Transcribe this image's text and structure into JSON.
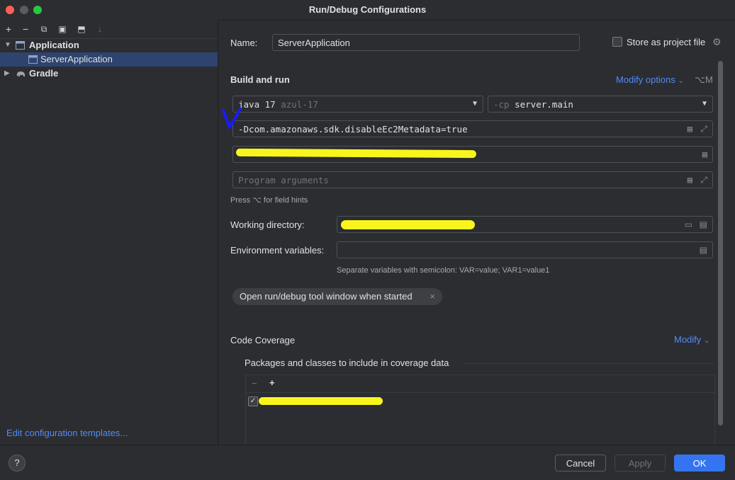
{
  "window": {
    "title": "Run/Debug Configurations"
  },
  "toolbar": {
    "add": "+",
    "remove": "−",
    "copy": "⧉",
    "save": "▣",
    "move": "⬒",
    "sort": "↓"
  },
  "tree": {
    "items": [
      {
        "label": "Application",
        "expanded": true,
        "icon": "application-folder-icon"
      },
      {
        "label": "ServerApplication",
        "selected": true,
        "icon": "application-config-icon"
      },
      {
        "label": "Gradle",
        "expanded": false,
        "icon": "gradle-elephant-icon"
      }
    ]
  },
  "left_footer": {
    "edit_templates": "Edit configuration templates..."
  },
  "form": {
    "name_label": "Name:",
    "name_value": "ServerApplication",
    "store_label": "Store as project file",
    "store_checked": false,
    "build_run_title": "Build and run",
    "modify_options": "Modify options",
    "modify_options_shortcut": "⌥M",
    "jdk_name": "java 17",
    "jdk_version": "azul-17",
    "cp_prefix": "-cp",
    "cp_value": "server.main",
    "vm_options": "-Dcom.amazonaws.sdk.disableEc2Metadata=true",
    "main_class": "",
    "program_args_placeholder": "Program arguments",
    "field_hint": "Press ⌥ for field hints",
    "workdir_label": "Working directory:",
    "workdir_value": "",
    "env_label": "Environment variables:",
    "env_value": "",
    "env_hint": "Separate variables with semicolon: VAR=value; VAR1=value1",
    "chip_label": "Open run/debug tool window when started",
    "chip_close": "×"
  },
  "coverage": {
    "title": "Code Coverage",
    "modify": "Modify",
    "packages_label": "Packages and classes to include in coverage data",
    "remove": "−",
    "add": "+",
    "entries": [
      {
        "checked": true,
        "value": ""
      }
    ]
  },
  "buttons": {
    "help": "?",
    "cancel": "Cancel",
    "apply": "Apply",
    "ok": "OK"
  },
  "colors": {
    "background": "#2b2d30",
    "selection": "#2e436e",
    "link": "#548af7",
    "primary_button": "#3574f0",
    "redaction": "#f8f51c",
    "annotation_pen": "#1a1aff"
  }
}
